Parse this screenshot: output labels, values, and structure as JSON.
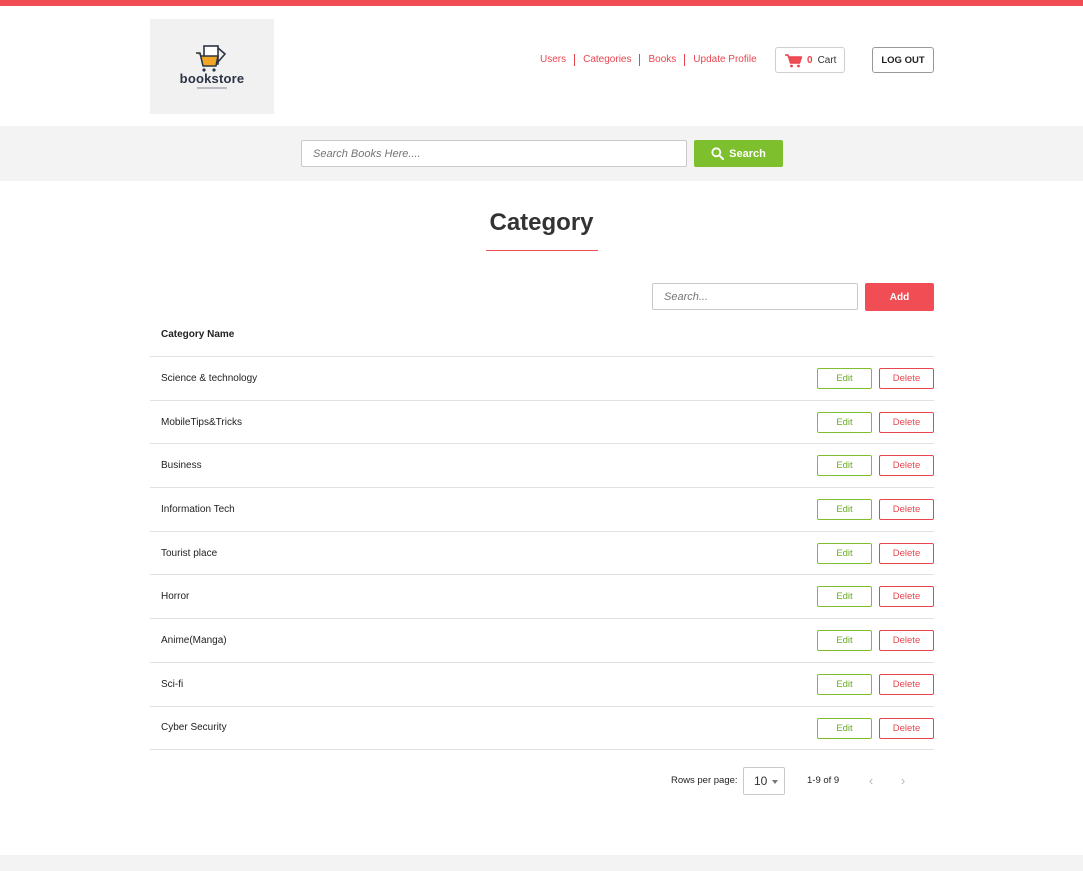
{
  "brand": {
    "name": "bookstore",
    "accent": "#f14d54",
    "green": "#7ebf2d"
  },
  "nav": {
    "items": [
      "Users",
      "Categories",
      "Books",
      "Update Profile"
    ]
  },
  "cart": {
    "count": "0",
    "label": "Cart",
    "icon": "cart-icon"
  },
  "logout": {
    "label": "LOG OUT"
  },
  "search": {
    "placeholder": "Search Books Here....",
    "button_label": "Search",
    "icon": "search-icon"
  },
  "page": {
    "title": "Category"
  },
  "toolbar": {
    "filter_placeholder": "Search...",
    "add_label": "Add"
  },
  "table": {
    "header": "Category Name",
    "edit_label": "Edit",
    "delete_label": "Delete",
    "rows": [
      "Science & technology",
      "MobileTips&Tricks",
      "Business",
      "Information Tech",
      "Tourist place",
      "Horror",
      "Anime(Manga)",
      "Sci-fi",
      "Cyber Security"
    ]
  },
  "pagination": {
    "rows_label": "Rows per page:",
    "rows_value": "10",
    "range": "1-9 of 9",
    "prev": "‹",
    "next": "›"
  }
}
